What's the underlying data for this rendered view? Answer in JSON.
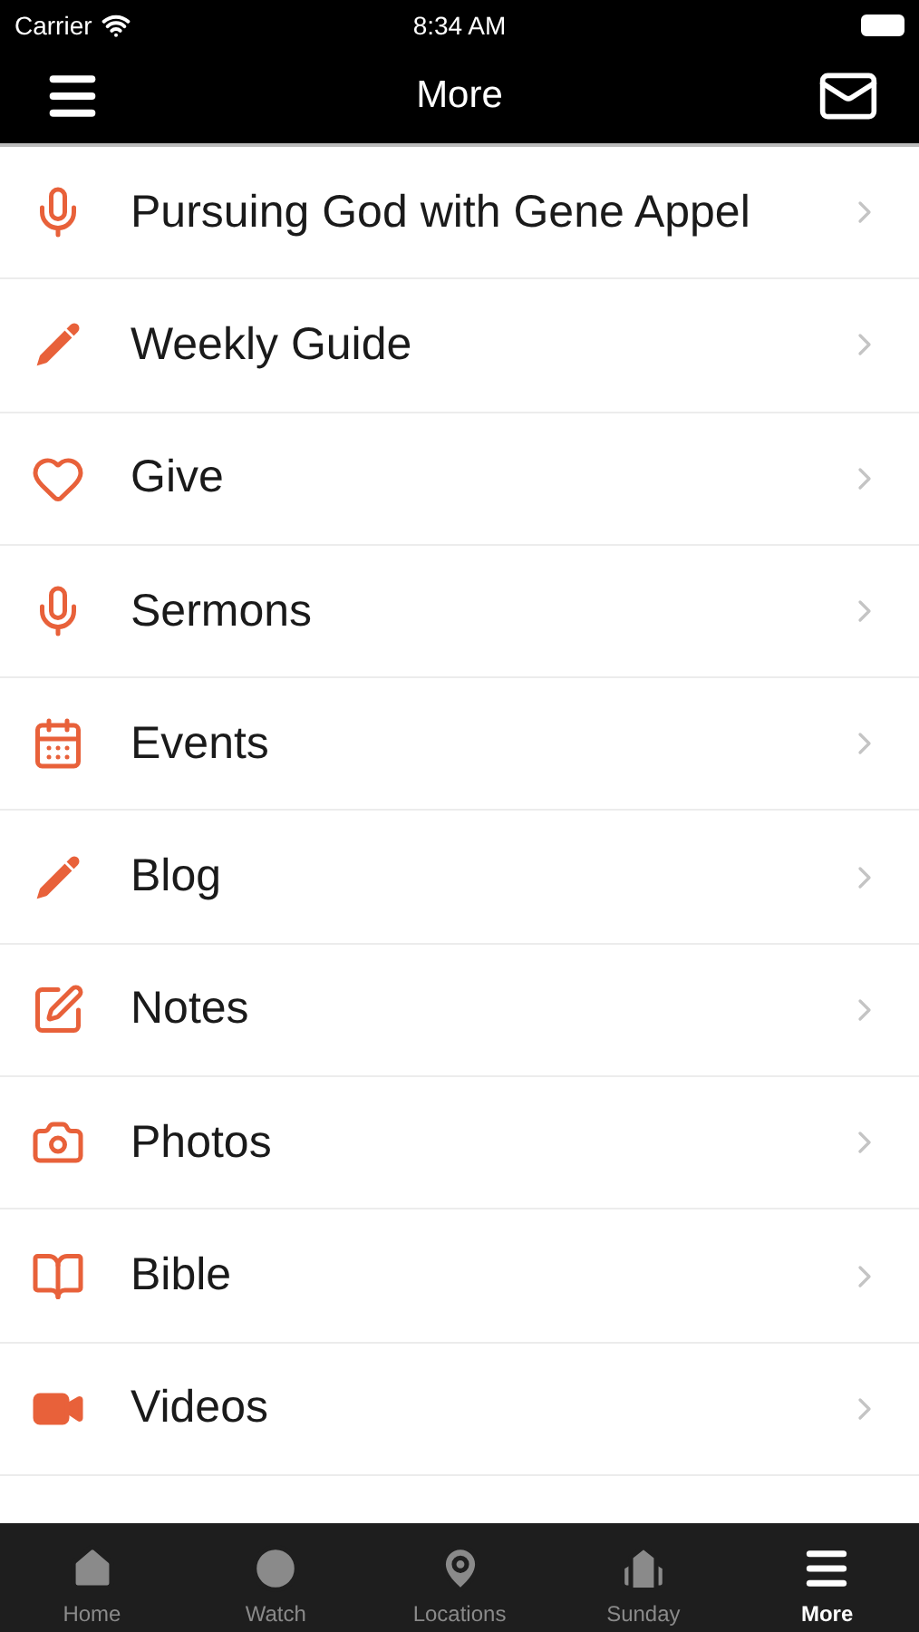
{
  "status_bar": {
    "carrier": "Carrier",
    "time": "8:34 AM"
  },
  "nav": {
    "title": "More"
  },
  "items": [
    {
      "label": "Pursuing God with Gene Appel"
    },
    {
      "label": "Weekly Guide"
    },
    {
      "label": "Give"
    },
    {
      "label": "Sermons"
    },
    {
      "label": "Events"
    },
    {
      "label": "Blog"
    },
    {
      "label": "Notes"
    },
    {
      "label": "Photos"
    },
    {
      "label": "Bible"
    },
    {
      "label": "Videos"
    }
  ],
  "tabs": [
    {
      "label": "Home",
      "selected": false
    },
    {
      "label": "Watch",
      "selected": false
    },
    {
      "label": "Locations",
      "selected": false
    },
    {
      "label": "Sunday",
      "selected": false
    },
    {
      "label": "More",
      "selected": true
    }
  ]
}
